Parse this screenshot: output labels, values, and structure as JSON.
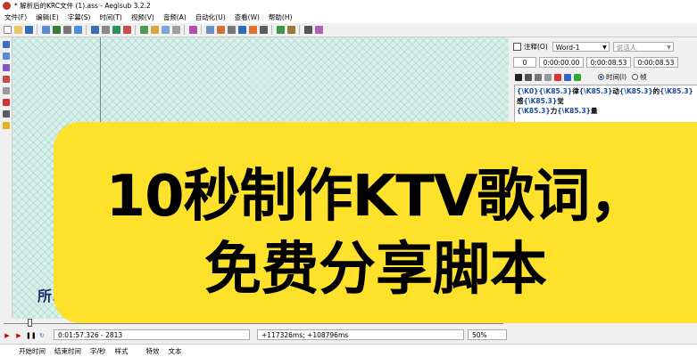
{
  "window": {
    "title": "* 解析后的KRC文件 (1).ass - Aegisub 3.2.2"
  },
  "menu": [
    "文件(F)",
    "编辑(E)",
    "字幕(S)",
    "时间(T)",
    "视频(V)",
    "音频(A)",
    "自动化(U)",
    "查看(W)",
    "帮助(H)"
  ],
  "colors": {
    "overlay_bg": "#fde12a",
    "video_bg": "#d8f0ea",
    "karaoke_tag": "#1a4aa0"
  },
  "video": {
    "subtitle_partial": "所以"
  },
  "editor": {
    "comment_label": "注释(O)",
    "style_value": "Word-1",
    "actor_placeholder": "说话人",
    "layer_value": "0",
    "start_time": "0:00:00.00",
    "end_time": "0:00:08.53",
    "duration": "0:00:08.53",
    "time_radio_label": "时间(I)",
    "frame_radio_label": "帧",
    "karaoke_lines": [
      [
        {
          "tag": "{\\K0}",
          "text": ""
        },
        {
          "tag": "{\\K85.3}",
          "text": "律"
        },
        {
          "tag": "{\\K85.3}",
          "text": "动"
        },
        {
          "tag": "{\\K85.3}",
          "text": "的"
        },
        {
          "tag": "{\\K85.3}",
          "text": "感"
        },
        {
          "tag": "{\\K85.3}",
          "text": "觉"
        }
      ],
      [
        {
          "tag": "{\\K85.3}",
          "text": "力"
        },
        {
          "tag": "{\\K85.3}",
          "text": "量"
        }
      ]
    ]
  },
  "playback": {
    "position": "0:01:57.326 - 2813",
    "offset": "+117326ms; +108796ms",
    "zoom": "50%"
  },
  "grid_headers": [
    "开始时间",
    "结束时间",
    "字/秒",
    "样式",
    "特效",
    "文本"
  ],
  "overlay": {
    "line1": "10秒制作KTV歌词，",
    "line2": "免费分享脚本"
  }
}
